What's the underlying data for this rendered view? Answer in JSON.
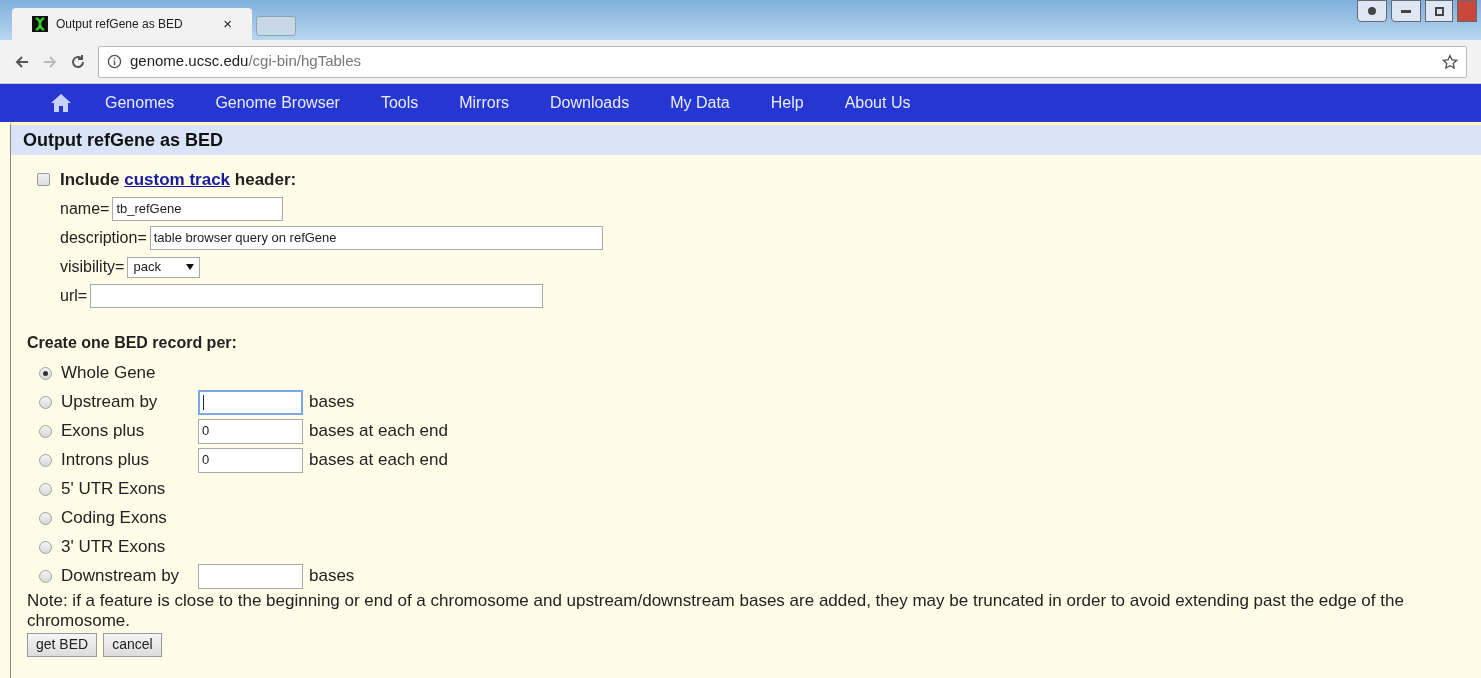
{
  "browser": {
    "tab": {
      "title": "Output refGene as BED",
      "close": "×"
    },
    "url": {
      "host": "genome.ucsc.edu",
      "path": "/cgi-bin/hgTables"
    }
  },
  "nav": {
    "items": [
      "Genomes",
      "Genome Browser",
      "Tools",
      "Mirrors",
      "Downloads",
      "My Data",
      "Help",
      "About Us"
    ]
  },
  "section_title": "Output refGene as BED",
  "header_option": {
    "checked": false,
    "before": "Include",
    "link": "custom track",
    "after": "header:"
  },
  "fields": [
    {
      "label": "name=",
      "value": "tb_refGene",
      "kind": "text"
    },
    {
      "label": "description=",
      "value": "table browser query on refGene",
      "kind": "text"
    },
    {
      "label": "visibility=",
      "value": "pack",
      "kind": "select"
    },
    {
      "label": "url=",
      "kind": "text"
    }
  ],
  "record_heading": "Create one BED record per:",
  "record_options": [
    {
      "label": "Whole Gene",
      "selected": true
    },
    {
      "label": "Upstream by",
      "selected": false,
      "input": {
        "focused": true
      },
      "suffix": "bases"
    },
    {
      "label": "Exons plus",
      "selected": false,
      "input": {
        "value": "0",
        "focused": false
      },
      "suffix": "bases at each end"
    },
    {
      "label": "Introns plus",
      "selected": false,
      "input": {
        "value": "0",
        "focused": false
      },
      "suffix": "bases at each end"
    },
    {
      "label": "5' UTR Exons",
      "selected": false
    },
    {
      "label": "Coding Exons",
      "selected": false
    },
    {
      "label": "3' UTR Exons",
      "selected": false
    },
    {
      "label": "Downstream by",
      "selected": false,
      "input": {
        "focused": false
      },
      "suffix": "bases"
    }
  ],
  "note": "Note: if a feature is close to the beginning or end of a chromosome and upstream/downstream bases are added, they may be truncated in order to avoid extending past the edge of the chromosome.",
  "buttons": [
    "get BED",
    "cancel"
  ]
}
